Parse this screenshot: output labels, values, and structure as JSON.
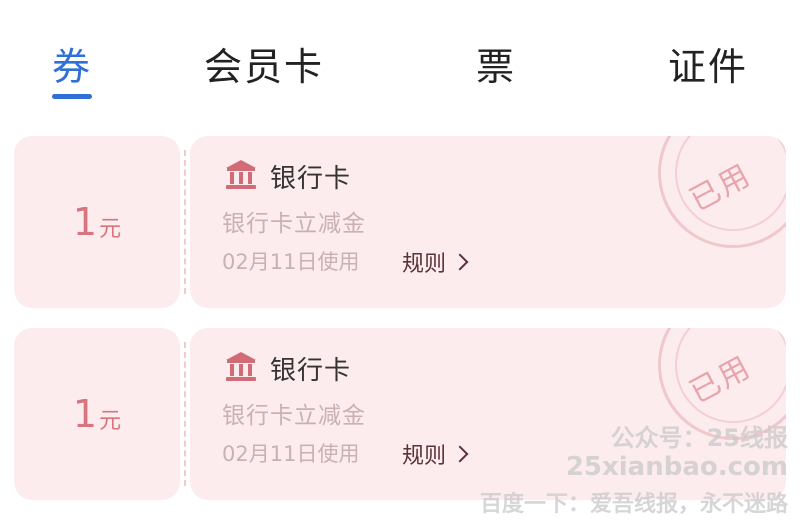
{
  "tabs": [
    {
      "label": "券",
      "active": true
    },
    {
      "label": "会员卡",
      "active": false
    },
    {
      "label": "票",
      "active": false
    },
    {
      "label": "证件",
      "active": false
    }
  ],
  "colors": {
    "accent": "#2f6fd6",
    "card_bg": "#fdecee",
    "amount": "#d7757e"
  },
  "coupons": [
    {
      "amount": "1",
      "unit": "元",
      "issuer": "银行卡",
      "issuer_icon": "bank-icon",
      "description": "银行卡立减金",
      "date_used": "02月11日使用",
      "rules_label": "规则",
      "stamp": "已用"
    },
    {
      "amount": "1",
      "unit": "元",
      "issuer": "银行卡",
      "issuer_icon": "bank-icon",
      "description": "银行卡立减金",
      "date_used": "02月11日使用",
      "rules_label": "规则",
      "stamp": "已用"
    }
  ],
  "watermark": {
    "line1": "公众号：25线报",
    "line2": "25xianbao.com",
    "line3": "百度一下：爱吾线报，永不迷路"
  }
}
